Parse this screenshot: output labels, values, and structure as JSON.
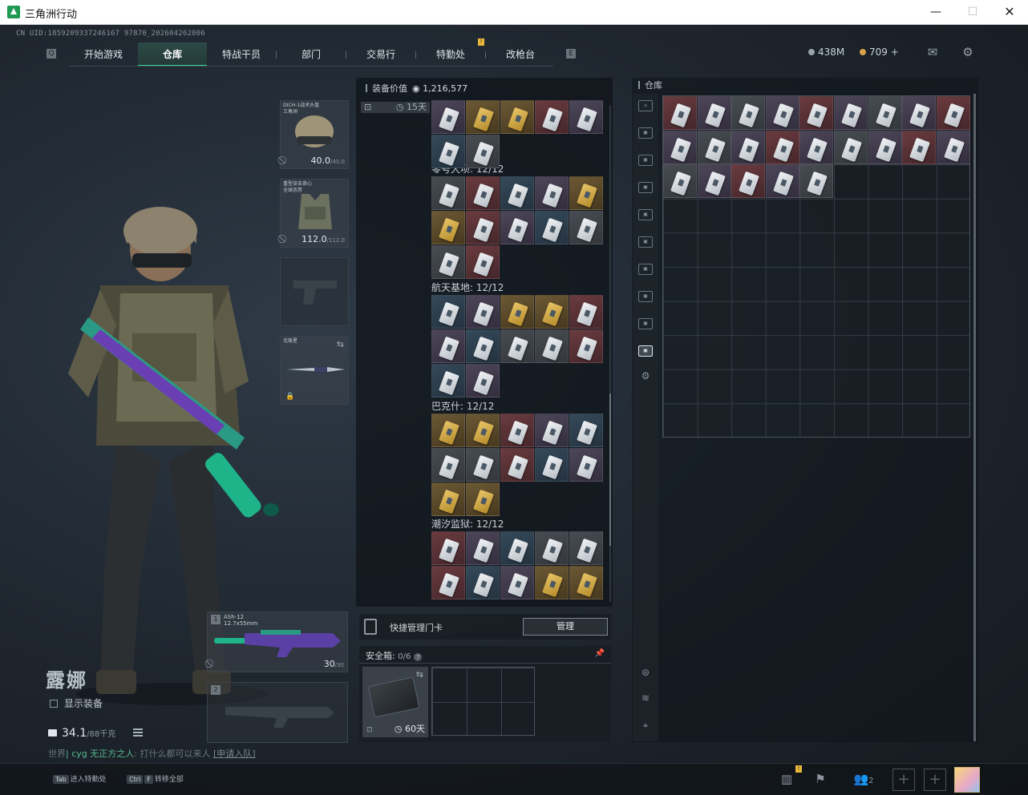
{
  "window": {
    "title": "三角洲行动"
  },
  "cnuid": "CN UID:1859209337246167 97870_202604262006",
  "nav": {
    "tabs": [
      {
        "label": "开始游戏"
      },
      {
        "label": "仓库"
      },
      {
        "label": "特战干员"
      },
      {
        "label": "部门"
      },
      {
        "label": "交易行"
      },
      {
        "label": "特勤处"
      },
      {
        "label": "改枪台"
      }
    ],
    "active_index": 1,
    "badge": "!"
  },
  "currency": {
    "coins": "438M",
    "points": "709 +"
  },
  "operator": {
    "name": "露娜",
    "show_equipment": "显示装备",
    "weight": "34.1",
    "weight_max": "/88千克",
    "recruit_prefix": "世界",
    "recruit_hl": "| cyg 无正方之人",
    "recruit_text": ": 打什么都可以来人 ",
    "recruit_link": "[申请入队]"
  },
  "equipment": {
    "helmet": {
      "label": "DICH-1战术头盔\n三角洲",
      "durability": "40.0",
      "durability_max": "/40.0"
    },
    "armor": {
      "label": "重型突击背心\n全球态势",
      "durability": "112.0",
      "durability_max": "/112.0"
    },
    "melee": {
      "label": "北极星"
    },
    "weapon1": {
      "slot": "1",
      "name": "ASh-12",
      "caliber": "12.7x55mm",
      "ammo": "30",
      "ammo_max": "/30"
    },
    "weapon2": {
      "slot": "2"
    }
  },
  "equipment_panel": {
    "title": "装备价值",
    "value": "1,216,577",
    "timer": "15天",
    "groups": [
      {
        "title": "零号大坝: 12/12"
      },
      {
        "title": "航天基地: 12/12"
      },
      {
        "title": "巴克什: 12/12"
      },
      {
        "title": "潮汐监狱: 12/12"
      }
    ],
    "quick_manage": "快捷管理门卡",
    "manage_button": "管理"
  },
  "safebox": {
    "title": "安全箱:",
    "count": "0/6",
    "help": "?",
    "timer": "60天"
  },
  "warehouse": {
    "title": "仓库"
  },
  "bottom": {
    "hotkey1_key": "Tab",
    "hotkey1_label": "进入特勤处",
    "hotkey2_key1": "Ctrl",
    "hotkey2_key2": "F",
    "hotkey2_label": "转移全部",
    "party_count": "2",
    "alert": "!"
  },
  "colors": {
    "accent": "#39d39c",
    "badge": "#e8b83a"
  }
}
